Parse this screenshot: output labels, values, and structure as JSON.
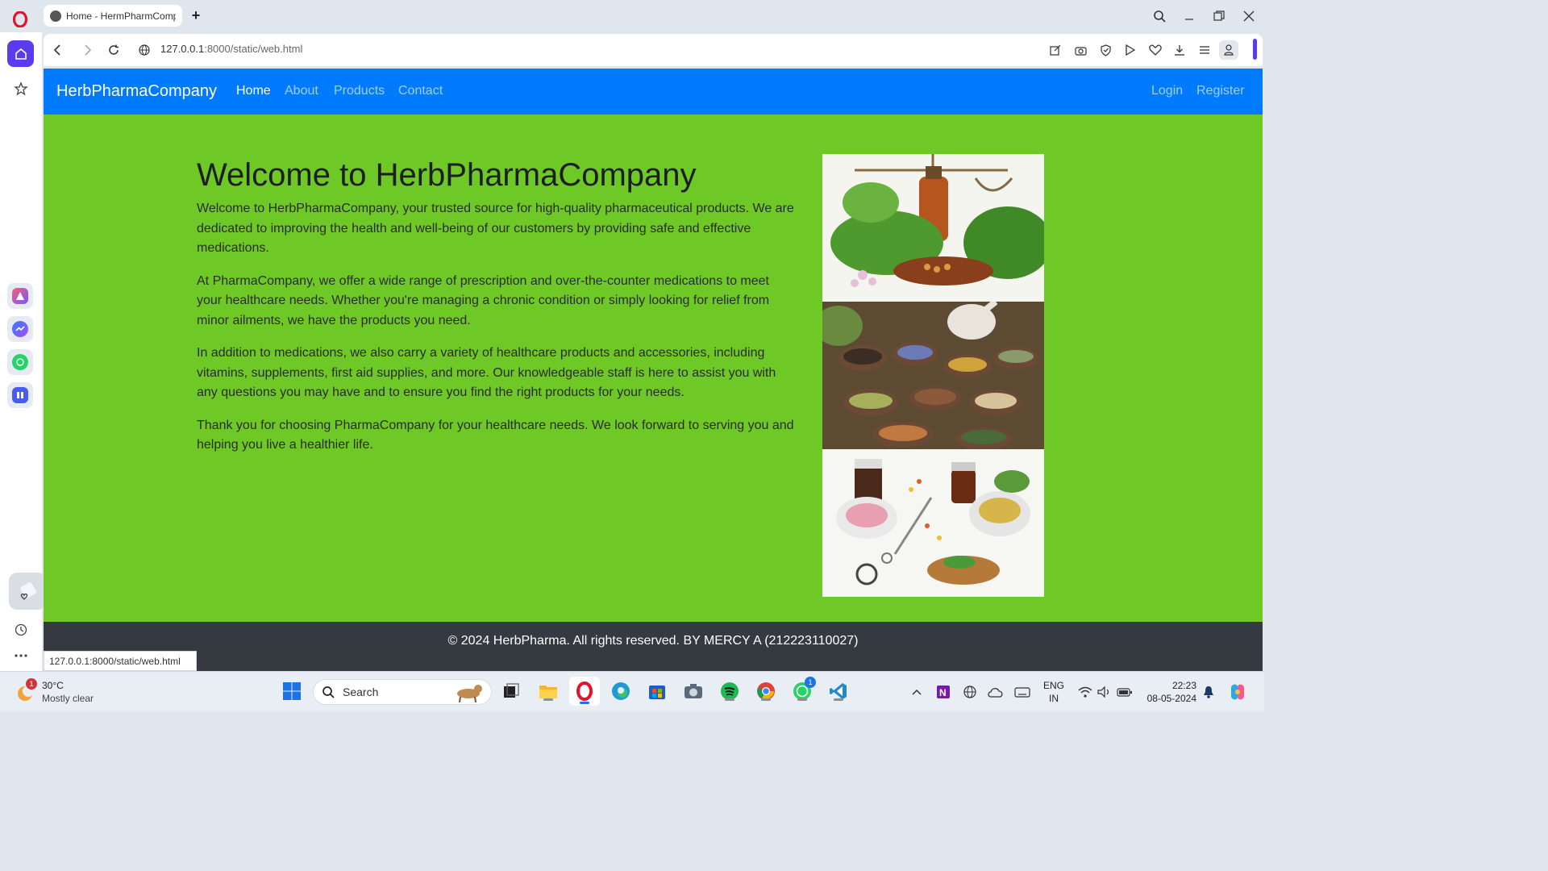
{
  "browser": {
    "tab_title": "Home - HermPharmComp",
    "url_host": "127.0.0.1",
    "url_rest": ":8000/static/web.html",
    "status_url": "127.0.0.1:8000/static/web.html"
  },
  "navbar": {
    "brand": "HerbPharmaCompany",
    "links": [
      "Home",
      "About",
      "Products",
      "Contact"
    ],
    "active": "Home",
    "auth": [
      "Login",
      "Register"
    ]
  },
  "main": {
    "heading": "Welcome to HerbPharmaCompany",
    "paragraphs": [
      "Welcome to HerbPharmaCompany, your trusted source for high-quality pharmaceutical products. We are dedicated to improving the health and well-being of our customers by providing safe and effective medications.",
      "At PharmaCompany, we offer a wide range of prescription and over-the-counter medications to meet your healthcare needs. Whether you're managing a chronic condition or simply looking for relief from minor ailments, we have the products you need.",
      "In addition to medications, we also carry a variety of healthcare products and accessories, including vitamins, supplements, first aid supplies, and more. Our knowledgeable staff is here to assist you with any questions you may have and to ensure you find the right products for your needs.",
      "Thank you for choosing PharmaCompany for your healthcare needs. We look forward to serving you and helping you live a healthier life."
    ]
  },
  "footer": {
    "text": "© 2024 HerbPharma. All rights reserved. BY MERCY A (212223110027)"
  },
  "taskbar": {
    "weather_temp": "30°C",
    "weather_cond": "Mostly clear",
    "weather_badge": "1",
    "search_placeholder": "Search",
    "whatsapp_badge": "1",
    "lang_top": "ENG",
    "lang_bottom": "IN",
    "time": "22:23",
    "date": "08-05-2024"
  },
  "colors": {
    "navbar": "#007bff",
    "page_bg": "#6ec826",
    "footer": "#343a40",
    "opera_accent": "#5b3bf0"
  }
}
